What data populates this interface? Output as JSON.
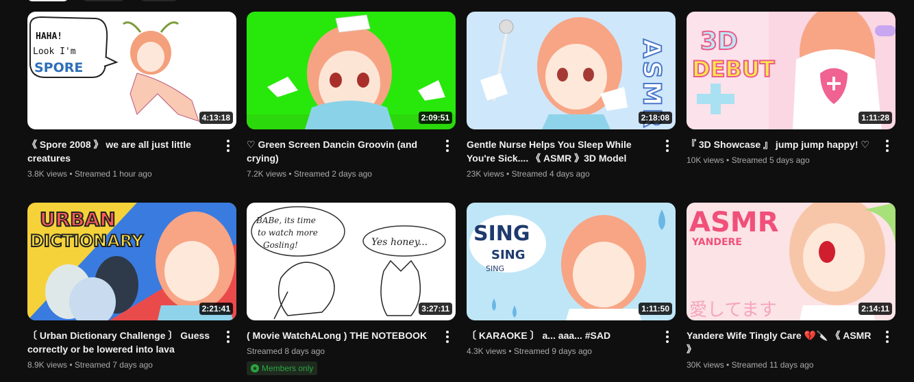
{
  "videos": [
    {
      "title": "《 Spore 2008 》 we are all just little creatures",
      "views": "3.8K views",
      "age": "Streamed 1 hour ago",
      "duration": "4:13:18",
      "thumb_text": [
        "HAHA!",
        "Look I'm",
        "SPORE"
      ]
    },
    {
      "title": "♡ Green Screen Dancin Groovin (and crying)",
      "views": "7.2K views",
      "age": "Streamed 2 days ago",
      "duration": "2:09:51"
    },
    {
      "title": "Gentle Nurse Helps You Sleep While You're Sick.... 《 ASMR 》3D Model",
      "views": "23K views",
      "age": "Streamed 4 days ago",
      "duration": "2:18:08",
      "thumb_text": [
        "ASMR"
      ]
    },
    {
      "title": "『 3D Showcase 』 jump jump happy! ♡",
      "views": "10K views",
      "age": "Streamed 5 days ago",
      "duration": "1:11:28",
      "thumb_text": [
        "3D",
        "DEBUT"
      ]
    },
    {
      "title": "〔 Urban Dictionary Challenge 〕 Guess correctly or be lowered into lava",
      "views": "8.9K views",
      "age": "Streamed 7 days ago",
      "duration": "2:21:41",
      "thumb_text": [
        "URBAN",
        "DICTIONARY"
      ]
    },
    {
      "title": "( Movie WatchALong ) THE NOTEBOOK",
      "views": "",
      "age": "Streamed 8 days ago",
      "duration": "3:27:11",
      "badge": "Members only",
      "thumb_text": [
        "BABe, its time",
        "to watch more",
        "Gosling!",
        "Yes honey..."
      ]
    },
    {
      "title": "〔 KARAOKE 〕 a... aaa... #SAD",
      "views": "4.3K views",
      "age": "Streamed 9 days ago",
      "duration": "1:11:50",
      "thumb_text": [
        "SING",
        "SING",
        "SING"
      ]
    },
    {
      "title": "Yandere Wife Tingly Care 💔🔪 《 ASMR 》",
      "views": "30K views",
      "age": "Streamed 11 days ago",
      "duration": "2:14:11",
      "thumb_text": [
        "ASMR",
        "YANDERE",
        "愛してます"
      ]
    }
  ],
  "meta_separator": " • ",
  "colors": {
    "background": "#0f0f0f",
    "members_badge": "#2ba640"
  }
}
